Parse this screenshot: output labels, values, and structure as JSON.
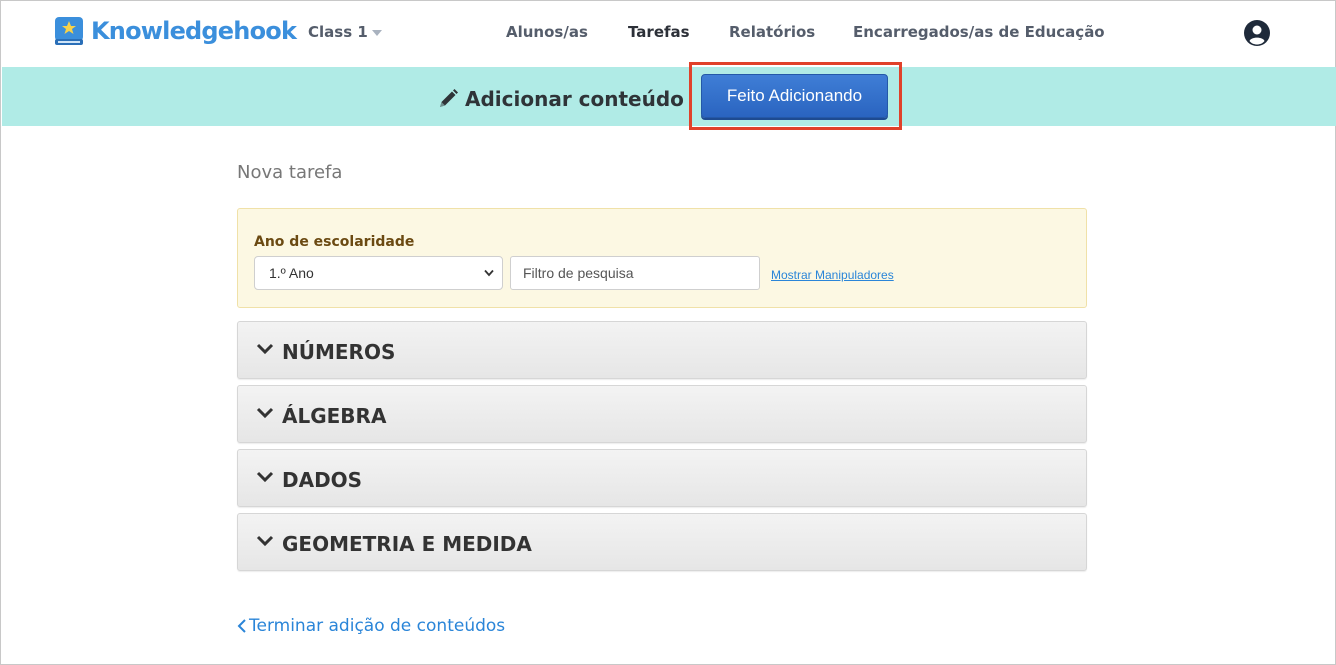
{
  "header": {
    "brand": "Knowledgehook",
    "class_label": "Class 1",
    "nav": [
      {
        "label": "Alunos/as",
        "active": false
      },
      {
        "label": "Tarefas",
        "active": true
      },
      {
        "label": "Relatórios",
        "active": false
      },
      {
        "label": "Encarregados/as de Educação",
        "active": false
      }
    ]
  },
  "banner": {
    "title": "Adicionar conteúdo",
    "done_button": "Feito Adicionando"
  },
  "main": {
    "subtitle": "Nova tarefa",
    "filter": {
      "label": "Ano de escolaridade",
      "grade_value": "1.º Ano",
      "search_placeholder": "Filtro de pesquisa",
      "manipulatives_link": "Mostrar Manipuladores"
    },
    "sections": [
      {
        "label": "NÚMEROS"
      },
      {
        "label": "ÁLGEBRA"
      },
      {
        "label": "DADOS"
      },
      {
        "label": "GEOMETRIA E MEDIDA"
      }
    ],
    "finish_link": "Terminar adição de conteúdos"
  },
  "colors": {
    "brand": "#3b8fdc",
    "banner_bg": "#b0ebe6",
    "primary_button": "#2f6fcc",
    "highlight": "#e0412a",
    "filter_bg": "#fcf8e3",
    "link": "#2a85d8"
  },
  "icons": [
    "logo-book-star-icon",
    "chevron-down-icon",
    "user-circle-icon",
    "pencil-icon",
    "chevron-left-icon"
  ]
}
